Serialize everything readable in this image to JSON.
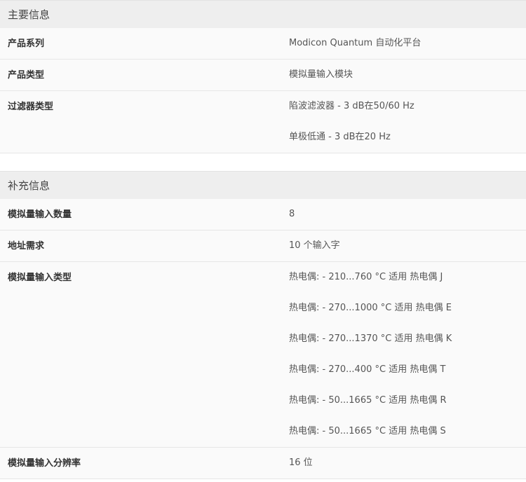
{
  "sections": [
    {
      "title": "主要信息",
      "rows": [
        {
          "label": "产品系列",
          "values": [
            "Modicon Quantum 自动化平台"
          ]
        },
        {
          "label": "产品类型",
          "values": [
            "模拟量输入模块"
          ]
        },
        {
          "label": "过滤器类型",
          "values": [
            "陷波滤波器 - 3 dB在50/60 Hz",
            "单极低通 - 3 dB在20 Hz"
          ]
        }
      ]
    },
    {
      "title": "补充信息",
      "rows": [
        {
          "label": "模拟量输入数量",
          "values": [
            "8"
          ]
        },
        {
          "label": "地址需求",
          "values": [
            "10 个输入字"
          ]
        },
        {
          "label": "模拟量输入类型",
          "values": [
            "热电偶: - 210...760 °C 适用 热电偶 J",
            "热电偶: - 270...1000 °C 适用 热电偶 E",
            "热电偶: - 270...1370 °C 适用 热电偶 K",
            "热电偶: - 270...400 °C 适用 热电偶 T",
            "热电偶: - 50...1665 °C 适用 热电偶 R",
            "热电偶: - 50...1665 °C 适用 热电偶 S"
          ]
        },
        {
          "label": "模拟量输入分辨率",
          "values": [
            "16 位"
          ]
        }
      ]
    }
  ]
}
